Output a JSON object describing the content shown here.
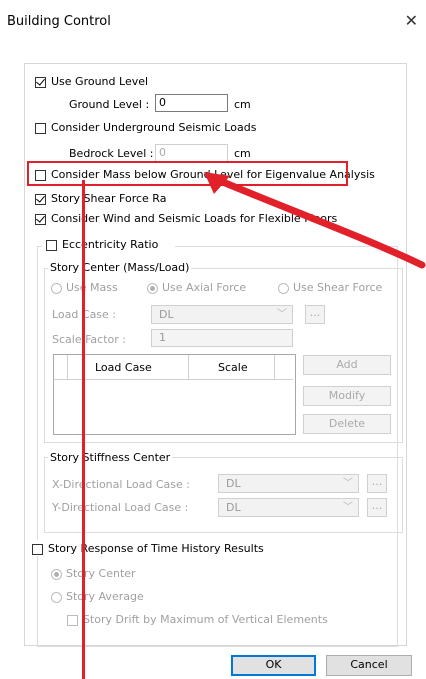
{
  "window": {
    "title": "Building Control",
    "close_icon": "close-icon"
  },
  "use_ground_level": {
    "label": "Use Ground Level",
    "checked": true
  },
  "ground_level": {
    "label": "Ground Level :",
    "value": "0",
    "unit": "cm"
  },
  "underground_seismic": {
    "label": "Consider Underground Seismic Loads",
    "checked": false
  },
  "bedrock_level": {
    "label": "Bedrock Level :",
    "value": "0",
    "unit": "cm"
  },
  "mass_below_ground": {
    "label": "Consider Mass below Ground Level for Eigenvalue Analysis",
    "checked": false
  },
  "story_shear_force": {
    "label": "Story Shear Force Ra",
    "checked": true
  },
  "flexible_floors": {
    "label": "Consider Wind and Seismic Loads for Flexible Floors",
    "checked": true
  },
  "eccentricity": {
    "label": "Eccentricity Ratio",
    "checked": false
  },
  "story_center": {
    "title": "Story Center (Mass/Load)",
    "radio_use_mass": "Use Mass",
    "radio_use_axial": "Use Axial Force",
    "radio_use_shear": "Use Shear Force",
    "selected": "Use Axial Force",
    "load_case_label": "Load Case :",
    "load_case_value": "DL",
    "scale_factor_label": "Scale Factor :",
    "scale_factor_value": "1",
    "table_headers": [
      "Load Case",
      "Scale"
    ],
    "add_label": "Add",
    "modify_label": "Modify",
    "delete_label": "Delete",
    "ellipsis": "..."
  },
  "stiffness_center": {
    "title": "Story Stiffness Center",
    "x_label": "X-Directional Load Case :",
    "x_value": "DL",
    "y_label": "Y-Directional Load Case :",
    "y_value": "DL",
    "ellipsis": "..."
  },
  "time_history": {
    "label": "Story Response of Time History Results",
    "checked": false
  },
  "th_story_center": {
    "label": "Story Center",
    "selected": true
  },
  "th_story_average": {
    "label": "Story Average",
    "selected": false
  },
  "story_drift": {
    "label": "Story Drift by Maximum of Vertical Elements",
    "checked": false
  },
  "footer": {
    "ok_label": "OK",
    "cancel_label": "Cancel"
  },
  "annotation_color": "#e2202a"
}
